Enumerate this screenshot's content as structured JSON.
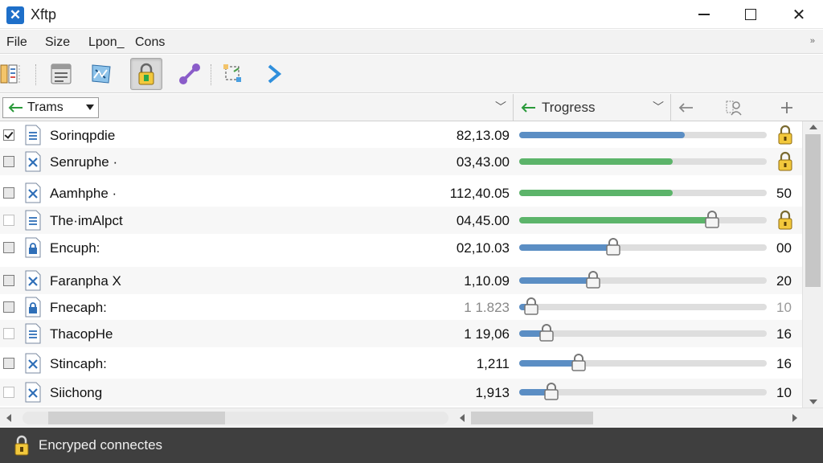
{
  "window": {
    "title": "Xftp",
    "app_icon": "x-logo-icon"
  },
  "menu": {
    "items": [
      "File",
      "Size",
      "Lpon_",
      "Cons"
    ]
  },
  "toolbar": {
    "tools": [
      "server-list-icon",
      "properties-icon",
      "transfer-icon",
      "lock-icon",
      "connect-icon",
      "sync-icon",
      "forward-icon"
    ],
    "active": "lock-icon"
  },
  "header": {
    "transfer_dropdown": "Trams",
    "progress_label": "Trogress"
  },
  "rows": [
    {
      "name": "Sorinqpdie",
      "value": "82,13.09",
      "progress": 0.67,
      "color": "blue",
      "slider": false,
      "checkbox": "checked",
      "file_icon": "doc",
      "right": "lock"
    },
    {
      "name": "Senruphe ·",
      "value": "03,43.00",
      "progress": 0.62,
      "color": "green",
      "slider": false,
      "checkbox": "filled",
      "file_icon": "x",
      "right": "lock"
    },
    {
      "name": "Aamhphe ·",
      "value": "112,40.05",
      "progress": 0.62,
      "color": "green",
      "slider": false,
      "checkbox": "filled",
      "file_icon": "x",
      "right": "50"
    },
    {
      "name": "The·imAlpct",
      "value": "04,45.00",
      "progress": 0.78,
      "color": "green",
      "slider": true,
      "checkbox": "empty",
      "file_icon": "doc",
      "right": "lock"
    },
    {
      "name": "Encuph:",
      "value": "02,10.03",
      "progress": 0.38,
      "color": "blue",
      "slider": true,
      "checkbox": "filled",
      "file_icon": "lockdoc",
      "right": "00"
    },
    {
      "name": "Faranpha X",
      "value": "1,10.09",
      "progress": 0.3,
      "color": "blue",
      "slider": true,
      "checkbox": "filled",
      "file_icon": "x",
      "right": "20"
    },
    {
      "name": "Fnecaph:",
      "value": "1 1.823",
      "value_dim": true,
      "progress": 0.05,
      "color": "blue",
      "slider": true,
      "checkbox": "filled",
      "file_icon": "lockdoc",
      "right": "10",
      "right_dim": true
    },
    {
      "name": "ThacopHe",
      "value": "1 19,06",
      "progress": 0.11,
      "color": "blue",
      "slider": true,
      "checkbox": "empty",
      "file_icon": "doc",
      "right": "16"
    },
    {
      "name": "Stincaph:",
      "value": "1,211",
      "progress": 0.24,
      "color": "blue",
      "slider": true,
      "checkbox": "filled",
      "file_icon": "x",
      "right": "16"
    },
    {
      "name": "Siichong",
      "value": "1,913",
      "progress": 0.13,
      "color": "blue",
      "slider": true,
      "checkbox": "empty",
      "file_icon": "x",
      "right": "10"
    }
  ],
  "status": {
    "text": "Encryped connectes"
  }
}
